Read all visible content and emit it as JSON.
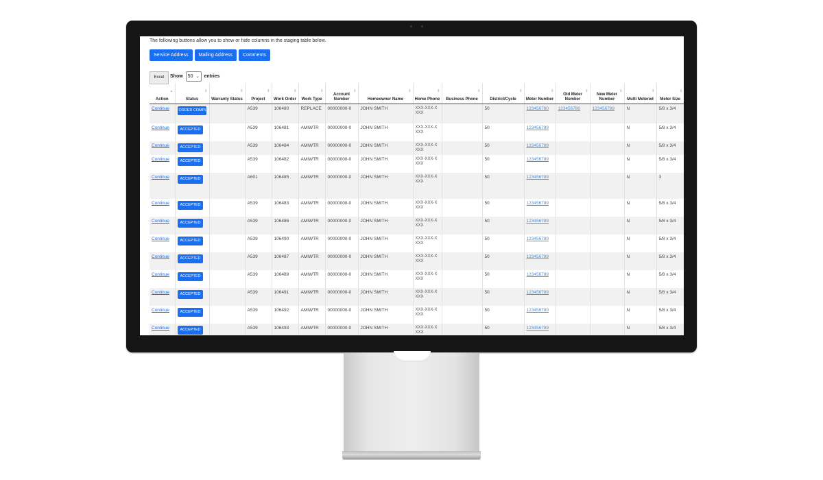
{
  "intro_text": "The following buttons allow you to show or hide columns in the staging table below.",
  "toggle_buttons": [
    "Service Address",
    "Mailing Address",
    "Comments"
  ],
  "controls": {
    "excel_label": "Excel",
    "show_label": "Show",
    "page_length": "50",
    "entries_label": "entries"
  },
  "columns": [
    "Action",
    "Status",
    "Warranty Status",
    "Project",
    "Work Order",
    "Work Type",
    "Account Number",
    "Homeowner Name",
    "Home Phone",
    "Business Phone",
    "District/Cycle",
    "Meter Number",
    "Old Meter Number",
    "New Meter Number",
    "Multi Metered",
    "Meter Size"
  ],
  "rows": [
    {
      "action": "Continue",
      "status": "ORDER COMPLETE",
      "project": "A539",
      "work_order": "106480",
      "work_type": "REPLACE",
      "account": "00000000-0",
      "name": "JOHN SMITH",
      "phone": "XXX-XXX-X XXX",
      "district": "50",
      "meter": "123456780",
      "old_meter": "123456780",
      "new_meter": "123456789",
      "multi": "N",
      "size": "5/8 x 3/4"
    },
    {
      "action": "Continue",
      "status": "ACCEPTED",
      "project": "A539",
      "work_order": "106481",
      "work_type": "AMIWTR",
      "account": "00000000-0",
      "name": "JOHN SMITH",
      "phone": "XXX-XXX-X XXX",
      "district": "50",
      "meter": "123456789",
      "old_meter": "",
      "new_meter": "",
      "multi": "N",
      "size": "5/8 x 3/4"
    },
    {
      "action": "Continue",
      "status": "ACCEPTED",
      "project": "A539",
      "work_order": "106484",
      "work_type": "AMIWTR",
      "account": "00000000-0",
      "name": "JOHN SMITH",
      "phone": "XXX-XXX-X XXX",
      "district": "50",
      "meter": "123456789",
      "old_meter": "",
      "new_meter": "",
      "multi": "N",
      "size": "5/8 x 3/4"
    },
    {
      "action": "Continue",
      "status": "ACCEPTED",
      "project": "A539",
      "work_order": "106482",
      "work_type": "AMIWTR",
      "account": "00000000-0",
      "name": "JOHN SMITH",
      "phone": "XXX-XXX-X XXX",
      "district": "50",
      "meter": "123456789",
      "old_meter": "",
      "new_meter": "",
      "multi": "N",
      "size": "5/8 x 3/4"
    },
    {
      "action": "Continue",
      "status": "ACCEPTED",
      "project": "A601",
      "work_order": "106485",
      "work_type": "AMIWTR",
      "account": "00000000-0",
      "name": "JOHN SMITH",
      "phone": "XXX-XXX-X XXX",
      "district": "50",
      "meter": "123456789",
      "old_meter": "",
      "new_meter": "",
      "multi": "N",
      "size": "3"
    },
    {
      "action": "Continue",
      "status": "ACCEPTED",
      "project": "A539",
      "work_order": "106483",
      "work_type": "AMIWTR",
      "account": "00000000-0",
      "name": "JOHN SMITH",
      "phone": "XXX-XXX-X XXX",
      "district": "50",
      "meter": "123456789",
      "old_meter": "",
      "new_meter": "",
      "multi": "N",
      "size": "5/8 x 3/4"
    },
    {
      "action": "Continue",
      "status": "ACCEPTED",
      "project": "A539",
      "work_order": "106486",
      "work_type": "AMIWTR",
      "account": "00000000-0",
      "name": "JOHN SMITH",
      "phone": "XXX-XXX-X XXX",
      "district": "50",
      "meter": "123456789",
      "old_meter": "",
      "new_meter": "",
      "multi": "N",
      "size": "5/8 x 3/4"
    },
    {
      "action": "Continue",
      "status": "ACCEPTED",
      "project": "A539",
      "work_order": "106490",
      "work_type": "AMIWTR",
      "account": "00000000-0",
      "name": "JOHN SMITH",
      "phone": "XXX-XXX-X XXX",
      "district": "50",
      "meter": "123456789",
      "old_meter": "",
      "new_meter": "",
      "multi": "N",
      "size": "5/8 x 3/4"
    },
    {
      "action": "Continue",
      "status": "ACCEPTED",
      "project": "A539",
      "work_order": "106487",
      "work_type": "AMIWTR",
      "account": "00000000-0",
      "name": "JOHN SMITH",
      "phone": "XXX-XXX-X XXX",
      "district": "50",
      "meter": "123456789",
      "old_meter": "",
      "new_meter": "",
      "multi": "N",
      "size": "5/8 x 3/4"
    },
    {
      "action": "Continue",
      "status": "ACCEPTED",
      "project": "A539",
      "work_order": "106489",
      "work_type": "AMIWTR",
      "account": "00000000-0",
      "name": "JOHN SMITH",
      "phone": "XXX-XXX-X XXX",
      "district": "50",
      "meter": "123456789",
      "old_meter": "",
      "new_meter": "",
      "multi": "N",
      "size": "5/8 x 3/4"
    },
    {
      "action": "Continue",
      "status": "ACCEPTED",
      "project": "A539",
      "work_order": "106491",
      "work_type": "AMIWTR",
      "account": "00000000-0",
      "name": "JOHN SMITH",
      "phone": "XXX-XXX-X XXX",
      "district": "50",
      "meter": "123456789",
      "old_meter": "",
      "new_meter": "",
      "multi": "N",
      "size": "5/8 x 3/4"
    },
    {
      "action": "Continue",
      "status": "ACCEPTED",
      "project": "A539",
      "work_order": "106492",
      "work_type": "AMIWTR",
      "account": "00000000-0",
      "name": "JOHN SMITH",
      "phone": "XXX-XXX-X XXX",
      "district": "50",
      "meter": "123456789",
      "old_meter": "",
      "new_meter": "",
      "multi": "N",
      "size": "5/8 x 3/4"
    },
    {
      "action": "Continue",
      "status": "ACCEPTED",
      "project": "A539",
      "work_order": "106493",
      "work_type": "AMIWTR",
      "account": "00000000-0",
      "name": "JOHN SMITH",
      "phone": "XXX-XXX-X XXX",
      "district": "50",
      "meter": "123456789",
      "old_meter": "",
      "new_meter": "",
      "multi": "N",
      "size": "5/8 x 3/4"
    }
  ],
  "colors": {
    "accent": "#1a6ff0",
    "bezel": "#151515",
    "stripe": "#f1f1f1"
  }
}
